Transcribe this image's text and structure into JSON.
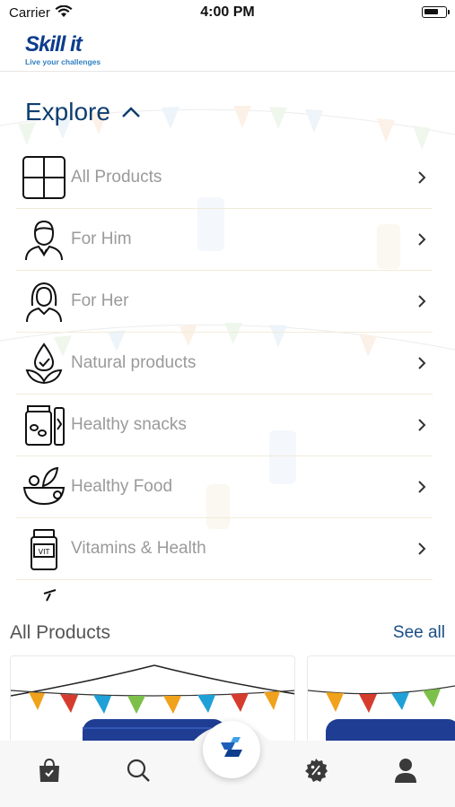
{
  "status_bar": {
    "carrier": "Carrier",
    "time": "4:00 PM",
    "battery_level": 0.7
  },
  "header": {
    "logo_text": "Skill it",
    "logo_tagline": "Live your challenges"
  },
  "explore": {
    "title": "Explore",
    "toggle_icon": "chevron-up-icon",
    "categories": [
      {
        "label": "All Products",
        "icon": "grid-icon"
      },
      {
        "label": "For Him",
        "icon": "man-icon"
      },
      {
        "label": "For Her",
        "icon": "woman-icon"
      },
      {
        "label": "Natural products",
        "icon": "leaf-drop-icon"
      },
      {
        "label": "Healthy snacks",
        "icon": "snack-jar-icon"
      },
      {
        "label": "Healthy Food",
        "icon": "salad-bowl-icon"
      },
      {
        "label": "Vitamins & Health",
        "icon": "vitamin-bottle-icon"
      }
    ]
  },
  "products_section": {
    "title": "All Products",
    "see_all": "See all"
  },
  "tab_bar": {
    "items": [
      {
        "name": "shop",
        "icon": "shopping-bag-icon"
      },
      {
        "name": "search",
        "icon": "search-icon"
      },
      {
        "name": "home",
        "icon": "skillit-logo-icon"
      },
      {
        "name": "offers",
        "icon": "discount-icon"
      },
      {
        "name": "account",
        "icon": "user-icon"
      }
    ]
  },
  "colors": {
    "brand": "#0e3e6f",
    "accent": "#1a4d86",
    "label": "#9a9a9a"
  }
}
